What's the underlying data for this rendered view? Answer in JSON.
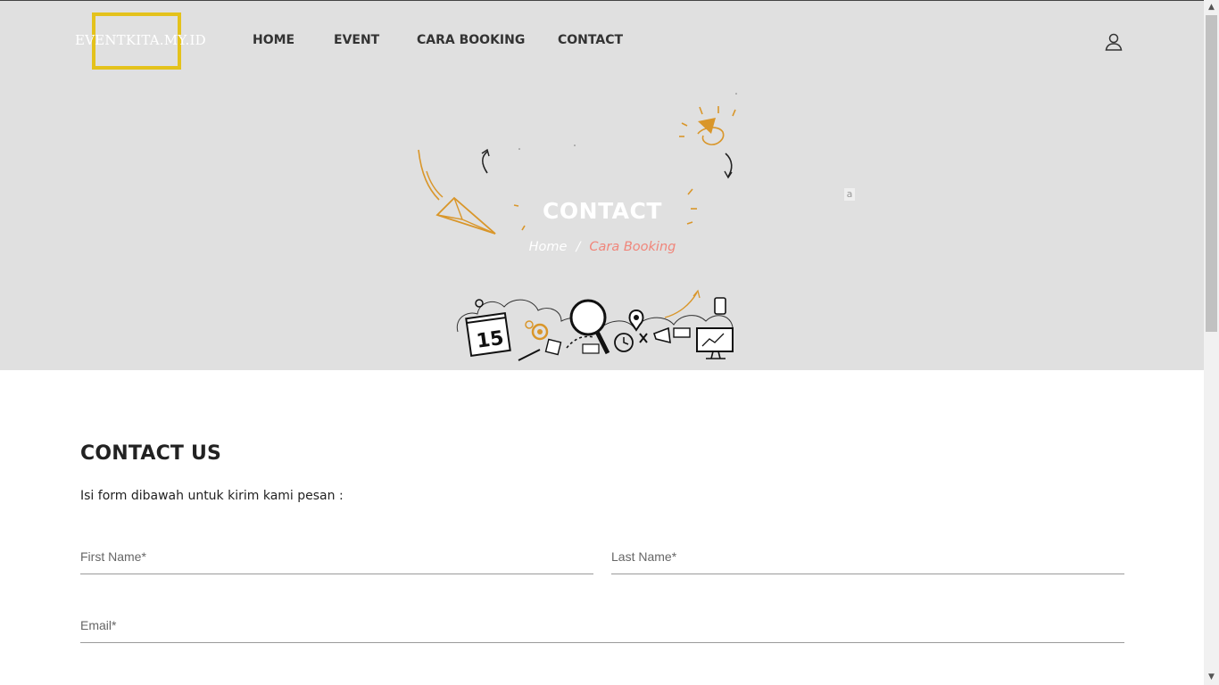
{
  "brand": {
    "logo_text": "EVENTKITA.MY.ID",
    "accent_color": "#e4c21c"
  },
  "nav": {
    "items": [
      {
        "label": "HOME"
      },
      {
        "label": "EVENT"
      },
      {
        "label": "CARA BOOKING"
      },
      {
        "label": "CONTACT"
      }
    ]
  },
  "header": {
    "user_icon": "user-icon"
  },
  "hero": {
    "title": "CONTACT",
    "breadcrumb": {
      "home": "Home",
      "separator": "/",
      "current": "Cara Booking"
    },
    "stray_label": "a",
    "background_color": "#e0e0e0"
  },
  "contact": {
    "title": "CONTACT US",
    "subtitle": "Isi form dibawah untuk kirim kami pesan :",
    "fields": {
      "first_name_placeholder": "First Name*",
      "last_name_placeholder": "Last Name*",
      "email_placeholder": "Email*"
    }
  },
  "colors": {
    "breadcrumb_current": "#f0857a",
    "doodle_orange": "#d9962a"
  }
}
